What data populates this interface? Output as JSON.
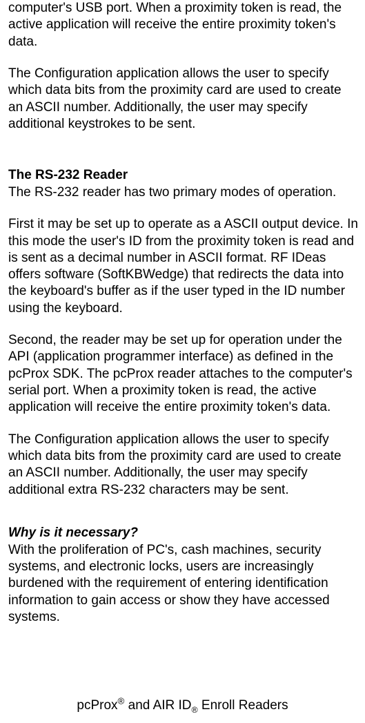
{
  "para1": "computer's USB port. When a proximity token is read, the active application will receive the entire proximity token's data.",
  "para2": "The Configuration application allows the user to specify which data bits from the proximity card are used to create an ASCII number. Additionally, the user may specify additional keystrokes to be sent.",
  "heading1": "The RS-232 Reader",
  "para3": "The RS-232 reader has two primary modes of operation.",
  "para4": "First it may be set up to operate as a ASCII output device. In this mode the user's ID from the proximity token is read and is sent as a decimal number in ASCII format. RF IDeas offers software (SoftKBWedge) that redirects the data into the keyboard's buffer as if the user typed in the ID number using the keyboard.",
  "para5": "Second, the reader may be set up for operation under the API (application programmer interface) as defined in the pcProx SDK. The pcProx reader attaches to the computer's serial port. When a proximity token is read, the active application will receive the entire proximity token's data.",
  "para6": "The Configuration application allows the user to specify which data bits from the proximity card are used to create an ASCII number. Additionally, the user may specify additional extra RS-232 characters may be sent.",
  "heading2": "Why is it necessary?",
  "para7": "With the proliferation of PC's, cash machines, security systems, and electronic locks, users are increasingly burdened with the requirement of entering identification information to gain access or show they have accessed systems.",
  "footer_pre": "pcProx",
  "footer_mid": " and AIR ID",
  "footer_post": " Enroll Readers",
  "reg": "®"
}
